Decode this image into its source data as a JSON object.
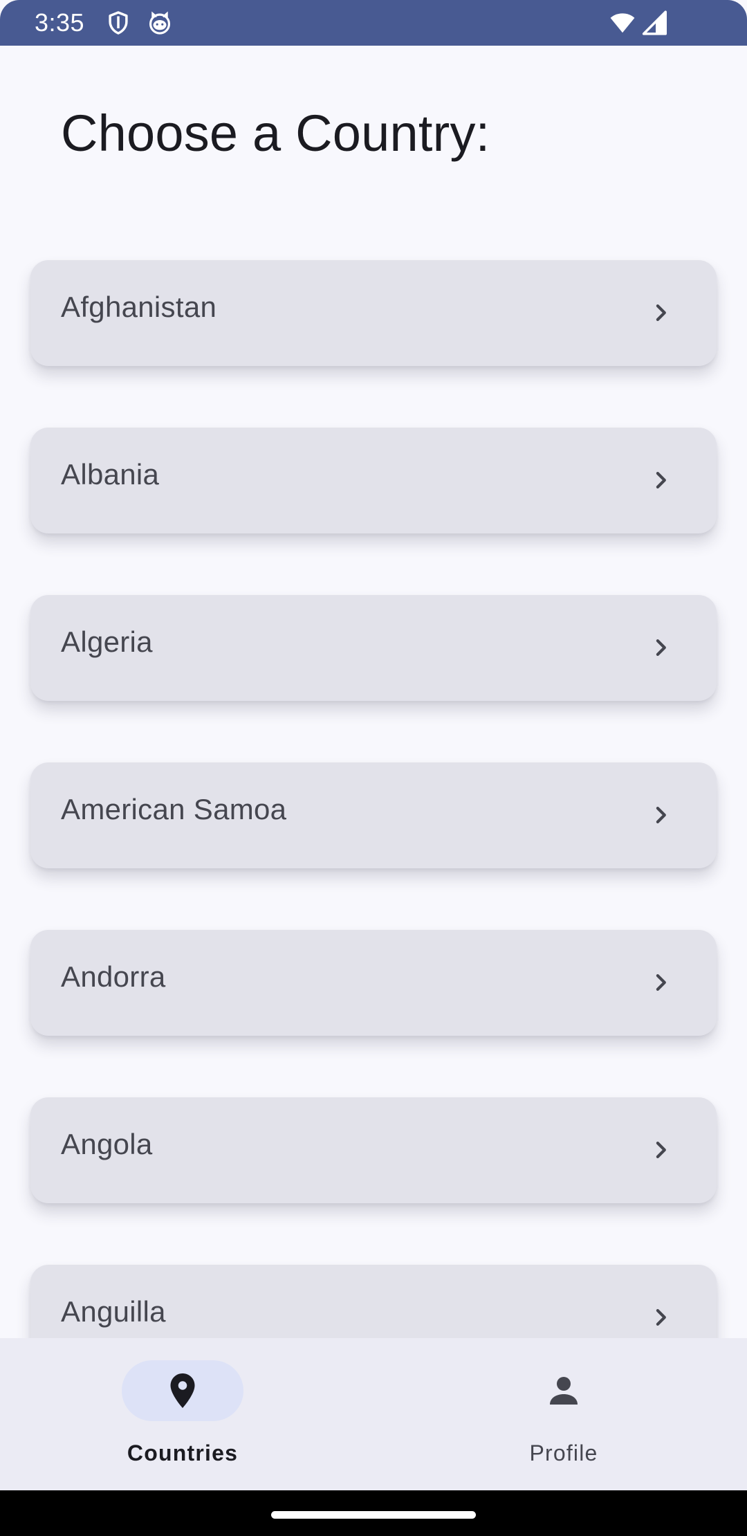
{
  "status_bar": {
    "time": "3:35",
    "icons": [
      "shield-icon",
      "cat-face-icon",
      "wifi-icon",
      "cellular-signal-icon"
    ],
    "background": "#485a92"
  },
  "page": {
    "title": "Choose a Country:"
  },
  "countries": [
    {
      "name": "Afghanistan"
    },
    {
      "name": "Albania"
    },
    {
      "name": "Algeria"
    },
    {
      "name": "American Samoa"
    },
    {
      "name": "Andorra"
    },
    {
      "name": "Angola"
    },
    {
      "name": "Anguilla"
    }
  ],
  "bottom_nav": {
    "items": [
      {
        "label": "Countries",
        "icon": "location-pin-icon",
        "selected": true
      },
      {
        "label": "Profile",
        "icon": "person-icon",
        "selected": false
      }
    ],
    "active_indicator_color": "#dde2f7"
  },
  "colors": {
    "background": "#f8f8fd",
    "card": "#e2e2ea",
    "text_primary": "#1b1b21",
    "text_secondary": "#45464f"
  }
}
